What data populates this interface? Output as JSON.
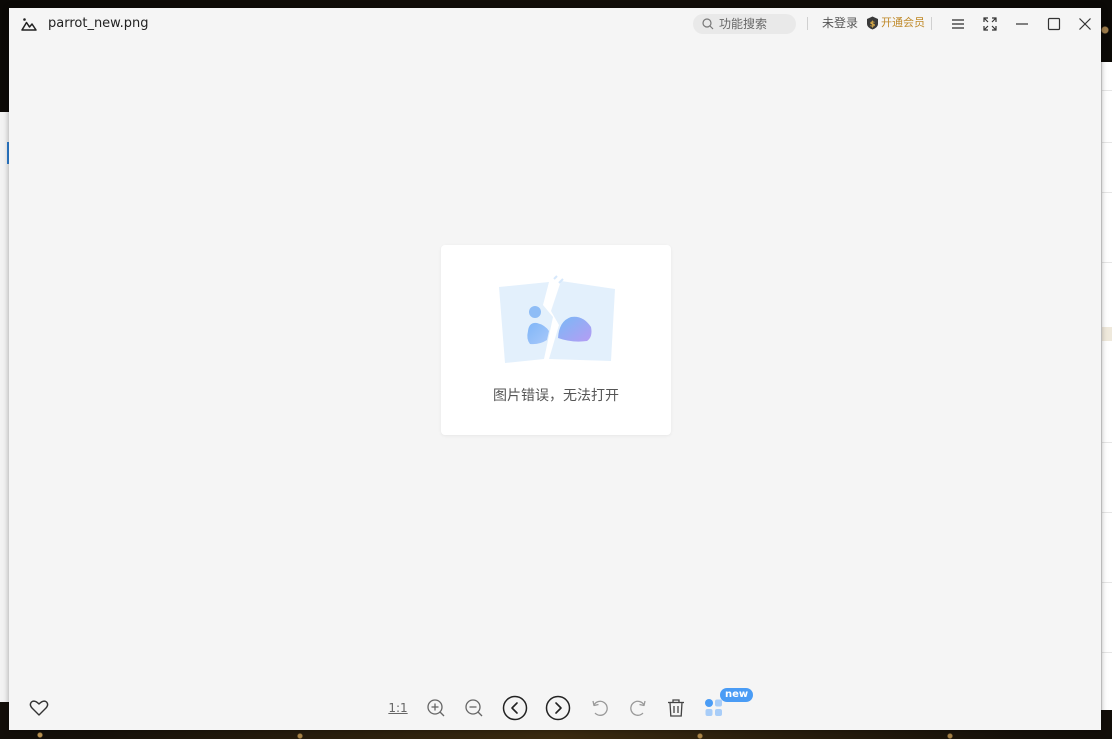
{
  "window": {
    "file_name": "parrot_new.png"
  },
  "header": {
    "search_placeholder": "功能搜索",
    "login_label": "未登录",
    "vip_label": "开通会员"
  },
  "viewer": {
    "error_message": "图片错误，无法打开"
  },
  "toolbar": {
    "actual_size_label": "1:1",
    "new_badge": "new"
  },
  "icons": {
    "app_logo": "mountain-logo-icon",
    "search": "search-icon",
    "vip": "vip-shield-icon",
    "menu": "hamburger-menu-icon",
    "fullscreen": "fullscreen-icon",
    "minimize": "minimize-icon",
    "maximize": "maximize-icon",
    "close": "close-icon",
    "favorite": "heart-icon",
    "zoom_in": "zoom-in-icon",
    "zoom_out": "zoom-out-icon",
    "prev": "chevron-left-circle-icon",
    "next": "chevron-right-circle-icon",
    "rotate_left": "rotate-left-icon",
    "rotate_right": "rotate-right-icon",
    "delete": "trash-icon",
    "apps": "apps-grid-icon"
  },
  "colors": {
    "vip_text": "#c08a2a",
    "new_badge_bg": "#4a9cf5",
    "canvas_bg": "#f5f5f5"
  }
}
